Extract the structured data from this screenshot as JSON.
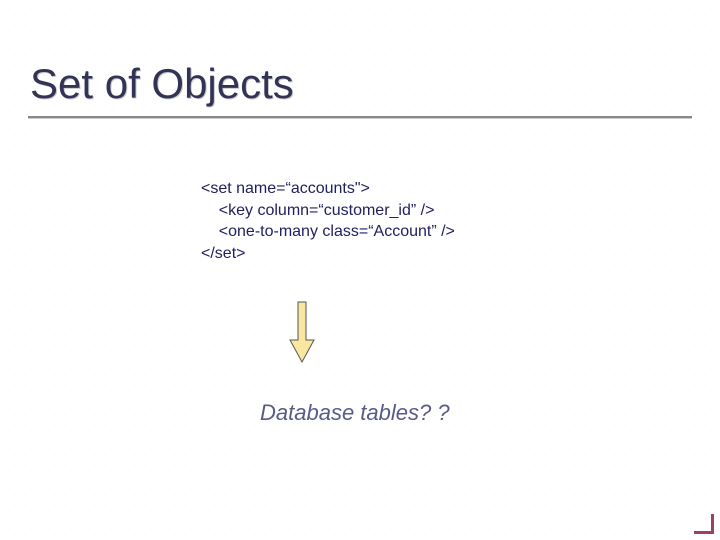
{
  "title": "Set of Objects",
  "code": {
    "line1": "<set name=“accounts\">",
    "line2": "    <key column=“customer_id” />",
    "line3": "    <one-to-many class=“Account” />",
    "line4": "</set>"
  },
  "caption": "Database tables? ?",
  "arrow": {
    "fill": "#f9e7a0",
    "stroke": "#555555"
  }
}
